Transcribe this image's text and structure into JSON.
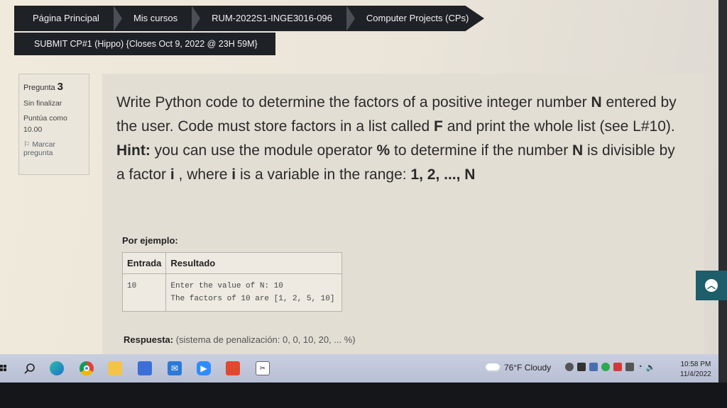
{
  "breadcrumb": {
    "items": [
      "Página Principal",
      "Mis cursos",
      "RUM-2022S1-INGE3016-096",
      "Computer Projects (CPs)"
    ]
  },
  "quiz": {
    "title": "SUBMIT CP#1 (Hippo) {Closes Oct 9, 2022 @ 23H 59M}"
  },
  "question_info": {
    "label": "Pregunta",
    "number": "3",
    "status": "Sin finalizar",
    "score_label": "Puntúa como",
    "score_value": "10.00",
    "flag_label": "Marcar pregunta"
  },
  "question": {
    "parts": [
      "Write Python code to determine the factors of a positive integer number ",
      "N",
      " entered by the user.  Code must store factors in a list called ",
      "F",
      " and print the whole list (see L#10). ",
      "Hint:",
      " you can use the module operator ",
      "%",
      " to determine if the number ",
      "N",
      " is divisible by a factor ",
      "i",
      " , where ",
      "i",
      " is a variable in the range: ",
      "1, 2, ..., N"
    ],
    "example_label": "Por ejemplo:",
    "table": {
      "headers": [
        "Entrada",
        "Resultado"
      ],
      "input": "10",
      "output_line1": "Enter the value of N: 10",
      "output_line2": "The factors of 10 are [1, 2, 5, 10]"
    },
    "answer_label": "Respuesta:",
    "penalty": "(sistema de penalización: 0, 0, 10, 20, ... %)"
  },
  "taskbar": {
    "weather": "76°F  Cloudy",
    "time": "10:58 PM",
    "date": "11/4/2022",
    "apps": [
      "search-icon",
      "edge-icon",
      "chrome-icon",
      "file-explorer-icon",
      "store-icon",
      "mail-icon",
      "zoom-icon",
      "office-icon",
      "snipping-tool-icon"
    ]
  },
  "colors": {
    "breadcrumb_bg": "#1e2226",
    "scroll_button": "#1d5e6a",
    "taskbar": "#c0c6da"
  }
}
